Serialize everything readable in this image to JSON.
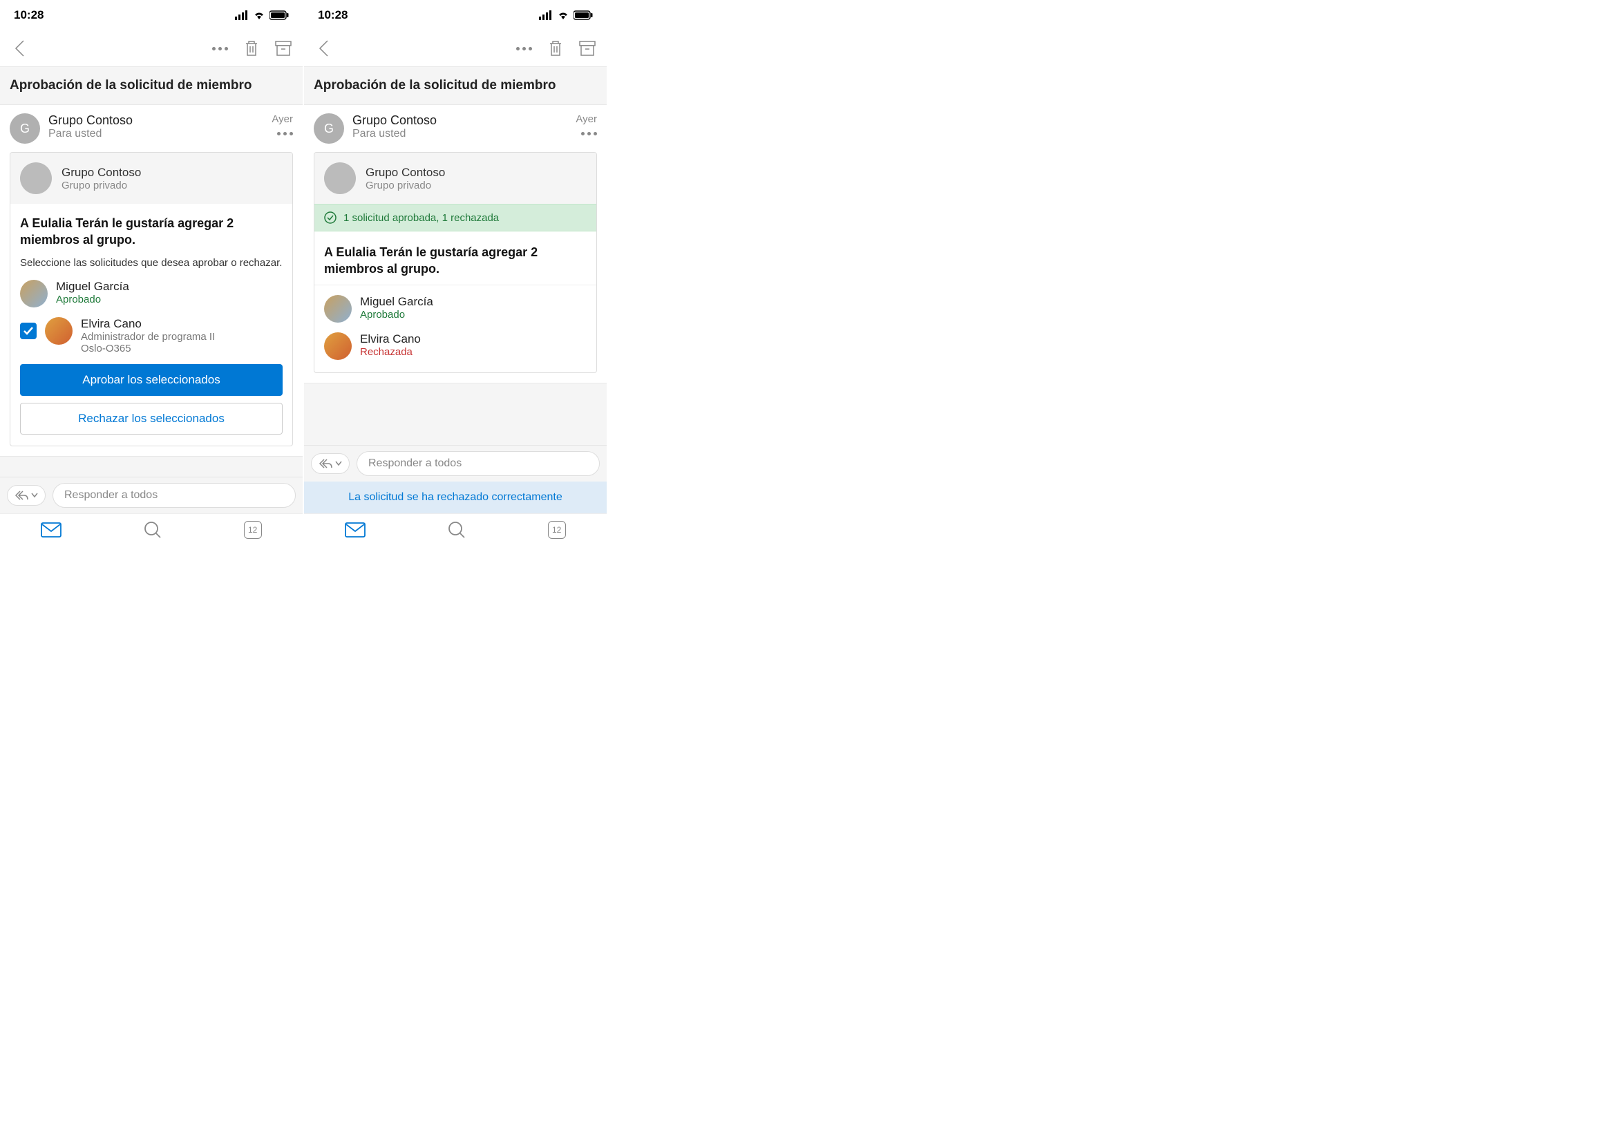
{
  "status": {
    "time": "10:28"
  },
  "subject": "Aprobación de la solicitud de miembro",
  "sender": {
    "initial": "G",
    "name": "Grupo Contoso",
    "to": "Para usted",
    "timestamp": "Ayer"
  },
  "card": {
    "group_name": "Grupo Contoso",
    "group_type": "Grupo privado",
    "request_heading": "A Eulalia Terán le gustaría agregar 2 miembros al grupo.",
    "instruction": "Seleccione las solicitudes que desea aprobar o rechazar.",
    "success_banner": "1 solicitud aprobada, 1 rechazada",
    "members": {
      "m1": {
        "name": "Miguel García",
        "status": "Aprobado"
      },
      "m2": {
        "name": "Elvira Cano",
        "role": "Administrador de programa II",
        "location": "Oslo-O365",
        "status_rejected": "Rechazada"
      }
    },
    "approve_btn": "Aprobar los seleccionados",
    "reject_btn": "Rechazar los seleccionados"
  },
  "reply_placeholder": "Responder a todos",
  "toast": "La solicitud se ha rechazado correctamente",
  "calendar_day": "12"
}
